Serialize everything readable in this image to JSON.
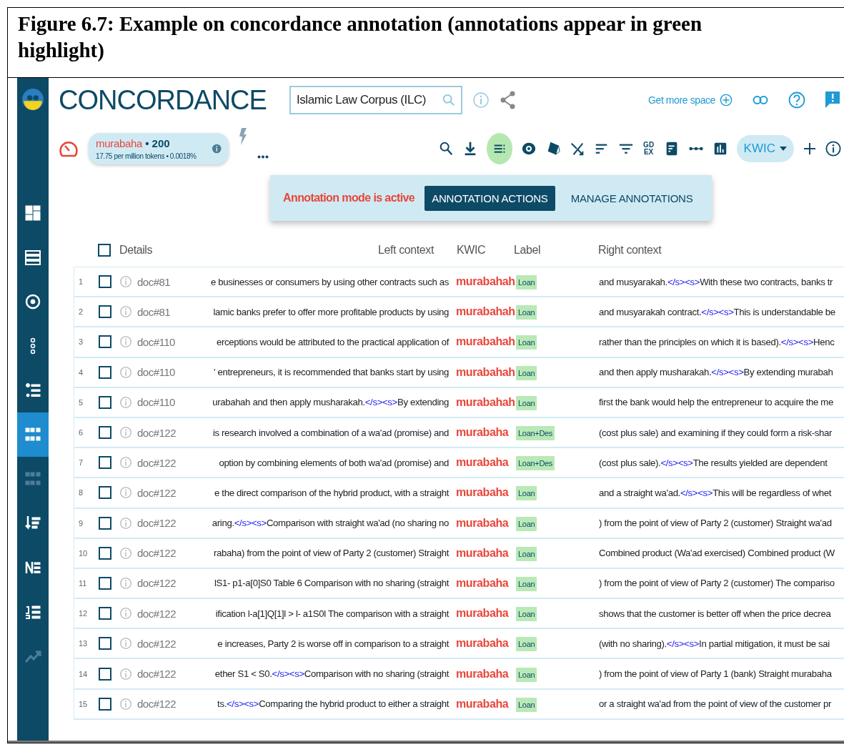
{
  "caption": {
    "label": "Figure 6.7:",
    "text": "Example on concordance annotation  (annotations appear in green highlight)"
  },
  "sidebar": {
    "items": [
      {
        "selected": false,
        "disabled": false
      },
      {
        "selected": false,
        "disabled": false
      },
      {
        "selected": false,
        "disabled": false
      },
      {
        "selected": false,
        "disabled": false
      },
      {
        "selected": false,
        "disabled": false
      },
      {
        "selected": true,
        "disabled": false
      },
      {
        "selected": false,
        "disabled": true
      },
      {
        "selected": false,
        "disabled": false
      },
      {
        "selected": false,
        "disabled": false
      },
      {
        "selected": false,
        "disabled": false
      },
      {
        "selected": false,
        "disabled": true
      }
    ]
  },
  "header": {
    "title": "CONCORDANCE",
    "corpus": "Islamic Law Corpus (ILC)",
    "more_space": "Get more space"
  },
  "query": {
    "term": "murabaha",
    "count": "• 200",
    "stats": "17.75 per million tokens • 0.0018%"
  },
  "tools": [
    {
      "selected": false
    },
    {
      "selected": false
    },
    {
      "selected": true
    },
    {
      "selected": false
    },
    {
      "selected": false
    },
    {
      "selected": false
    },
    {
      "selected": false
    },
    {
      "selected": false
    },
    {
      "selected": false,
      "label": "GD EX"
    },
    {
      "selected": false
    },
    {
      "selected": false
    },
    {
      "selected": false
    }
  ],
  "view": "KWIC",
  "annotation": {
    "status": "Annotation mode is active",
    "tabs": [
      {
        "label": "ANNOTATION ACTIONS",
        "selected": true
      },
      {
        "label": "MANAGE ANNOTATIONS",
        "selected": false
      }
    ]
  },
  "table": {
    "columns": [
      "Details",
      "Left context",
      "KWIC",
      "Label",
      "Right context"
    ],
    "header_checked": false,
    "rows": [
      {
        "n": "1",
        "checked": false,
        "doc": "doc#81",
        "left": [
          {
            "text": "e businesses or consumers by using other contracts such as",
            "tag": false
          }
        ],
        "kwic": "murabahah",
        "label": "Loan",
        "right": [
          {
            "text": "and musyarakah.",
            "tag": false
          },
          {
            "text": "</s><s>",
            "tag": true
          },
          {
            "text": "With these two contracts, banks tr",
            "tag": false
          }
        ]
      },
      {
        "n": "2",
        "checked": false,
        "doc": "doc#81",
        "left": [
          {
            "text": "lamic banks prefer to offer more profitable products by using",
            "tag": false
          }
        ],
        "kwic": "murabahah",
        "label": "Loan",
        "right": [
          {
            "text": "and musyarakah contract.",
            "tag": false
          },
          {
            "text": "</s><s>",
            "tag": true
          },
          {
            "text": "This is understandable be",
            "tag": false
          }
        ]
      },
      {
        "n": "3",
        "checked": false,
        "doc": "doc#110",
        "left": [
          {
            "text": "erceptions would be attributed to the practical application of",
            "tag": false
          }
        ],
        "kwic": "murabahah",
        "label": "Loan",
        "right": [
          {
            "text": "rather than the principles on which it is based).",
            "tag": false
          },
          {
            "text": "</s><s>",
            "tag": true
          },
          {
            "text": "Henc",
            "tag": false
          }
        ]
      },
      {
        "n": "4",
        "checked": false,
        "doc": "doc#110",
        "left": [
          {
            "text": "' entrepreneurs, it is recommended that banks start by using",
            "tag": false
          }
        ],
        "kwic": "murabahah",
        "label": "Loan",
        "right": [
          {
            "text": "and then apply musharakah.",
            "tag": false
          },
          {
            "text": "</s><s>",
            "tag": true
          },
          {
            "text": "By extending murabah",
            "tag": false
          }
        ]
      },
      {
        "n": "5",
        "checked": false,
        "doc": "doc#110",
        "left": [
          {
            "text": "urabahah and then apply musharakah.",
            "tag": false
          },
          {
            "text": "</s><s>",
            "tag": true
          },
          {
            "text": "By extending",
            "tag": false
          }
        ],
        "kwic": "murabahah",
        "label": "Loan",
        "right": [
          {
            "text": "first the bank would help the entrepreneur to acquire the me",
            "tag": false
          }
        ]
      },
      {
        "n": "6",
        "checked": false,
        "doc": "doc#122",
        "left": [
          {
            "text": "is research involved a combination of a wa'ad (promise) and",
            "tag": false
          }
        ],
        "kwic": "murabaha",
        "label": "Loan+Des",
        "right": [
          {
            "text": "(cost plus sale) and examining if they could form a risk-shar",
            "tag": false
          }
        ]
      },
      {
        "n": "7",
        "checked": false,
        "doc": "doc#122",
        "left": [
          {
            "text": "option by combining elements of both wa'ad (promise) and",
            "tag": false
          }
        ],
        "kwic": "murabaha",
        "label": "Loan+Des",
        "right": [
          {
            "text": "(cost plus sale).",
            "tag": false
          },
          {
            "text": "</s><s>",
            "tag": true
          },
          {
            "text": "The results yielded are dependent",
            "tag": false
          }
        ]
      },
      {
        "n": "8",
        "checked": false,
        "doc": "doc#122",
        "left": [
          {
            "text": "e the direct comparison of the hybrid product, with a straight",
            "tag": false
          }
        ],
        "kwic": "murabaha",
        "label": "Loan",
        "right": [
          {
            "text": "and a straight wa'ad.",
            "tag": false
          },
          {
            "text": "</s><s>",
            "tag": true
          },
          {
            "text": "This will be regardless of whet",
            "tag": false
          }
        ]
      },
      {
        "n": "9",
        "checked": false,
        "doc": "doc#122",
        "left": [
          {
            "text": "aring.",
            "tag": false
          },
          {
            "text": "</s><s>",
            "tag": true
          },
          {
            "text": "Comparison with straight wa'ad (no sharing no",
            "tag": false
          }
        ],
        "kwic": "murabaha",
        "label": "Loan",
        "right": [
          {
            "text": ") from the point of view of Party 2 (customer) Straight wa'ad",
            "tag": false
          }
        ]
      },
      {
        "n": "10",
        "checked": false,
        "doc": "doc#122",
        "left": [
          {
            "text": "rabaha) from the point of view of Party 2 (customer) Straight",
            "tag": false
          }
        ],
        "kwic": "murabaha",
        "label": "Loan",
        "right": [
          {
            "text": "Combined product (Wa'ad exercised) Combined product (W",
            "tag": false
          }
        ]
      },
      {
        "n": "11",
        "checked": false,
        "doc": "doc#122",
        "left": [
          {
            "text": "lS1- p1-a[0]S0 Table 6 Comparison with no sharing (straight",
            "tag": false
          }
        ],
        "kwic": "murabaha",
        "label": "Loan",
        "right": [
          {
            "text": ") from the point of view of Party 2 (customer) The compariso",
            "tag": false
          }
        ]
      },
      {
        "n": "12",
        "checked": false,
        "doc": "doc#122",
        "left": [
          {
            "text": "ification l-a[1]Q[1]l > l- a1S0l The comparison with a straight",
            "tag": false
          }
        ],
        "kwic": "murabaha",
        "label": "Loan",
        "right": [
          {
            "text": "shows that the customer is better off when the price decrea",
            "tag": false
          }
        ]
      },
      {
        "n": "13",
        "checked": false,
        "doc": "doc#122",
        "left": [
          {
            "text": "e increases, Party 2 is worse off in comparison to a straight",
            "tag": false
          }
        ],
        "kwic": "murabaha",
        "label": "Loan",
        "right": [
          {
            "text": "(with no sharing).",
            "tag": false
          },
          {
            "text": "</s><s>",
            "tag": true
          },
          {
            "text": "In partial mitigation, it must be sai",
            "tag": false
          }
        ]
      },
      {
        "n": "14",
        "checked": false,
        "doc": "doc#122",
        "left": [
          {
            "text": "ether S1 < S0.",
            "tag": false
          },
          {
            "text": "</s><s>",
            "tag": true
          },
          {
            "text": "Comparison with no sharing (straight",
            "tag": false
          }
        ],
        "kwic": "murabaha",
        "label": "Loan",
        "right": [
          {
            "text": ") from the point of view of Party 1 (bank) Straight murabaha",
            "tag": false
          }
        ]
      },
      {
        "n": "15",
        "checked": false,
        "doc": "doc#122",
        "left": [
          {
            "text": "ts.",
            "tag": false
          },
          {
            "text": "</s><s>",
            "tag": true
          },
          {
            "text": "Comparing the hybrid product to either a straight",
            "tag": false
          }
        ],
        "kwic": "murabaha",
        "label": "Loan",
        "right": [
          {
            "text": "or a straight wa'ad from the point of view of the customer pr",
            "tag": false
          }
        ]
      }
    ]
  }
}
